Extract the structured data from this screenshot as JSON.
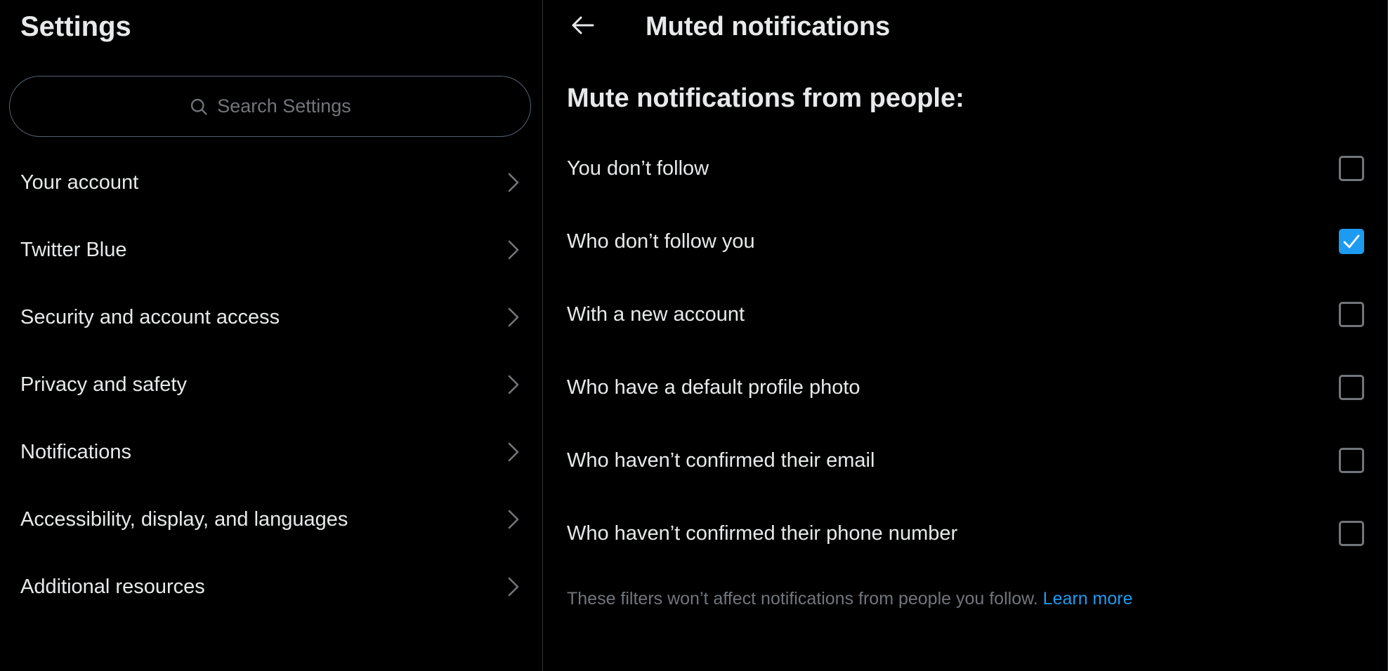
{
  "sidebar": {
    "title": "Settings",
    "search": {
      "placeholder": "Search Settings",
      "icon": "search-icon"
    },
    "items": [
      {
        "label": "Your account"
      },
      {
        "label": "Twitter Blue"
      },
      {
        "label": "Security and account access"
      },
      {
        "label": "Privacy and safety"
      },
      {
        "label": "Notifications"
      },
      {
        "label": "Accessibility, display, and languages"
      },
      {
        "label": "Additional resources"
      }
    ],
    "item_icon": "chevron-right-icon"
  },
  "main": {
    "back_icon": "arrow-left-icon",
    "title": "Muted notifications",
    "section_heading": "Mute notifications from people:",
    "options": [
      {
        "label": "You don’t follow",
        "checked": false
      },
      {
        "label": "Who don’t follow you",
        "checked": true
      },
      {
        "label": "With a new account",
        "checked": false
      },
      {
        "label": "Who have a default profile photo",
        "checked": false
      },
      {
        "label": "Who haven’t confirmed their email",
        "checked": false
      },
      {
        "label": "Who haven’t confirmed their phone number",
        "checked": false
      }
    ],
    "footnote": "These filters won’t affect notifications from people you follow.",
    "learn_more": "Learn more"
  },
  "colors": {
    "background": "#000000",
    "text": "#e7e9ea",
    "muted_text": "#71767b",
    "accent": "#1d9bf0",
    "divider": "#2f3336"
  }
}
